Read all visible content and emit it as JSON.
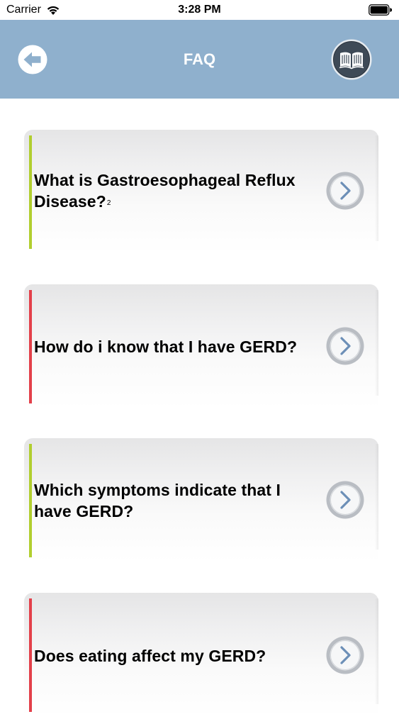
{
  "status_bar": {
    "carrier": "Carrier",
    "time": "3:28 PM"
  },
  "nav": {
    "title": "FAQ",
    "back_icon": "back-arrow-icon",
    "book_icon": "book-icon"
  },
  "colors": {
    "nav_background": "#8fb0cd",
    "accent_green": "#b1ce2f",
    "accent_red": "#e3404a",
    "chevron": "#6c8fb7"
  },
  "faq": {
    "items": [
      {
        "question": "What is Gastroesophageal Reflux Disease?",
        "superscript": "2",
        "accent": "green"
      },
      {
        "question": "How do i know that I have GERD?",
        "accent": "red"
      },
      {
        "question": "Which symptoms indicate that I have GERD?",
        "accent": "green"
      },
      {
        "question": "Does eating affect my GERD?",
        "accent": "red"
      }
    ]
  }
}
